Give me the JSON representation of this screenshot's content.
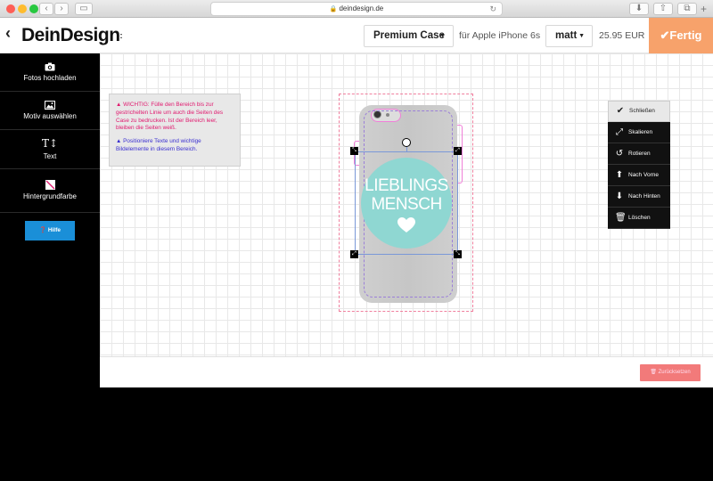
{
  "browser": {
    "url": "deindesign.de",
    "colors": {
      "close": "#fe5f57",
      "minimize": "#febc2e",
      "maximize": "#28c840"
    }
  },
  "header": {
    "logo": "DeinDesign",
    "case_select": "Premium Case",
    "device_text": "für Apple iPhone 6s",
    "finish_select": "matt",
    "price": "25.95 EUR",
    "done_label": "Fertig",
    "done_color": "#f7a26b"
  },
  "sidebar": {
    "items": [
      {
        "label": "Fotos hochladen",
        "icon": "camera-icon"
      },
      {
        "label": "Motiv auswählen",
        "icon": "image-icon"
      },
      {
        "label": "Text",
        "icon": "text-icon"
      },
      {
        "label": "Hintergrundfarbe",
        "icon": "color-swatch-icon"
      }
    ],
    "help_label": "Hilfe",
    "help_color": "#1a8fd8"
  },
  "notice": {
    "warning": "WICHTIG: Fülle den Bereich bis zur gestrichelten Linie um auch die Seiten des Case zu bedrucken. Ist der Bereich leer, bleiben die Seiten weiß.",
    "hint": "Positioniere Texte und wichtige Bildelemente in diesem Bereich."
  },
  "edit_menu": {
    "items": [
      {
        "label": "Schließen",
        "icon": "check-icon"
      },
      {
        "label": "Skalieren",
        "icon": "resize-icon"
      },
      {
        "label": "Rotieren",
        "icon": "rotate-icon"
      },
      {
        "label": "Nach Vorne",
        "icon": "arrow-up-circle-icon"
      },
      {
        "label": "Nach Hinten",
        "icon": "arrow-down-circle-icon"
      },
      {
        "label": "Löschen",
        "icon": "trash-icon"
      }
    ]
  },
  "design": {
    "line1": "LIEBLINGS",
    "line2": "MENSCH",
    "circle_color": "#8fd7d2"
  },
  "bottom": {
    "reset_label": "Zurücksetzen",
    "reset_color": "#f27a7a"
  }
}
